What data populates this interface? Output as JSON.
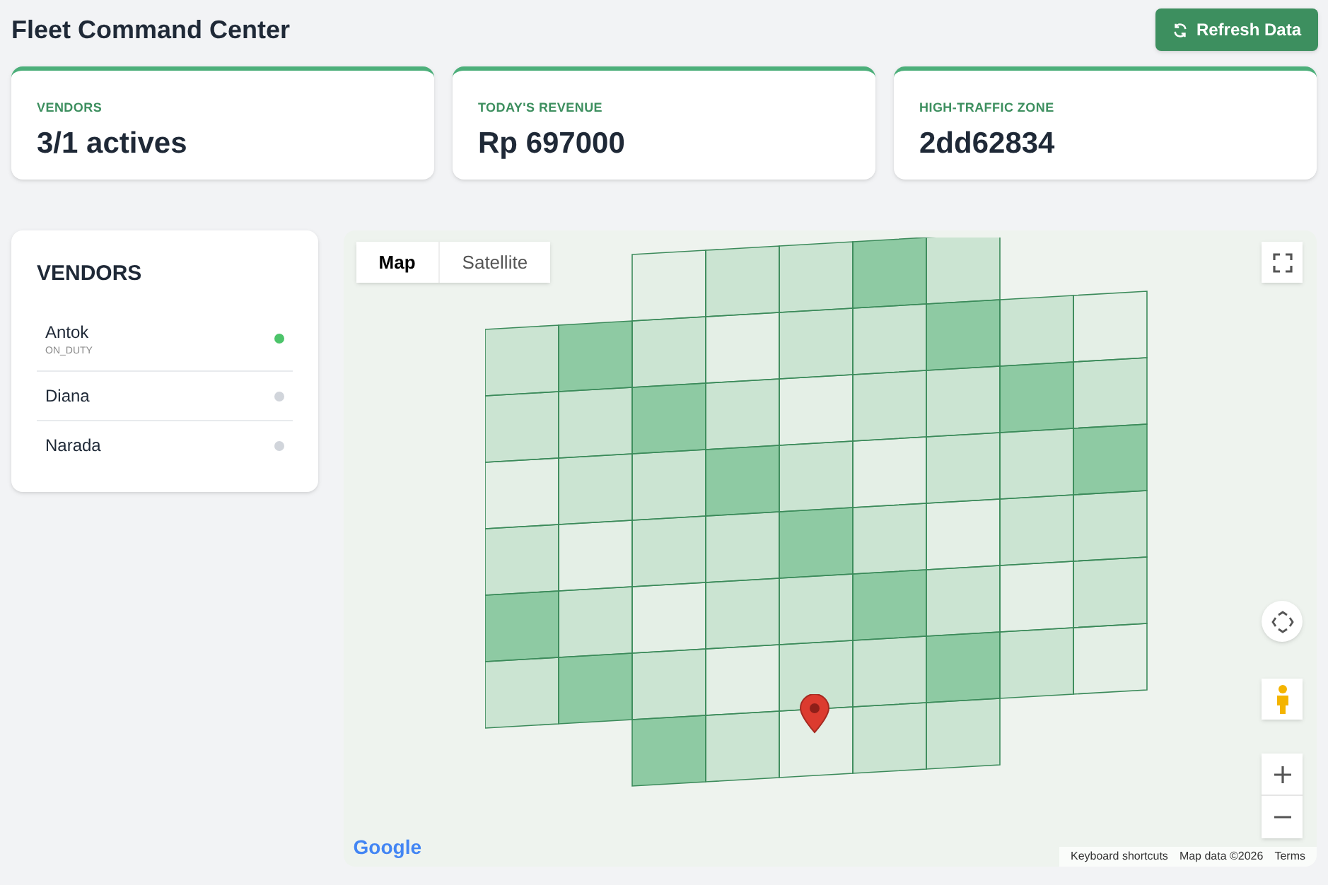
{
  "header": {
    "title": "Fleet Command Center",
    "refresh_button": "Refresh Data"
  },
  "stats": [
    {
      "label": "VENDORS",
      "value": "3/1 actives"
    },
    {
      "label": "TODAY'S REVENUE",
      "value": "Rp 697000"
    },
    {
      "label": "HIGH-TRAFFIC ZONE",
      "value": "2dd62834"
    }
  ],
  "vendors": {
    "title": "VENDORS",
    "items": [
      {
        "name": "Antok",
        "status": "ON_DUTY",
        "on": true
      },
      {
        "name": "Diana",
        "on": false
      },
      {
        "name": "Narada",
        "on": false
      }
    ]
  },
  "map": {
    "tabs": [
      {
        "label": "Map",
        "selected": true
      },
      {
        "label": "Satellite",
        "selected": false
      }
    ],
    "logo": "Google",
    "attribution": [
      "Keyboard shortcuts",
      "Map data ©2026",
      "Terms"
    ]
  }
}
